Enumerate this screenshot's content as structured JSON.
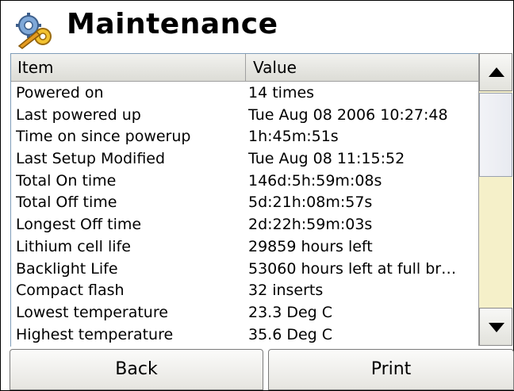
{
  "window": {
    "title": "Maintenance",
    "icon": "gears-icon"
  },
  "table": {
    "columns": [
      "Item",
      "Value"
    ],
    "rows": [
      [
        "Powered on",
        "14 times"
      ],
      [
        "Last powered up",
        "Tue Aug 08 2006 10:27:48"
      ],
      [
        "Time on since powerup",
        "1h:45m:51s"
      ],
      [
        "Last Setup Modified",
        "Tue Aug 08 11:15:52"
      ],
      [
        "Total On time",
        "146d:5h:59m:08s"
      ],
      [
        "Total Off time",
        "5d:21h:08m:57s"
      ],
      [
        "Longest Off time",
        "2d:22h:59m:03s"
      ],
      [
        "Lithium cell life",
        "29859 hours left"
      ],
      [
        "Backlight Life",
        "53060 hours left at full br…"
      ],
      [
        "Compact flash",
        "32 inserts"
      ],
      [
        "Lowest temperature",
        "23.3 Deg C"
      ],
      [
        "Highest temperature",
        "35.6 Deg C"
      ]
    ]
  },
  "scrollbar": {
    "up_icon": "arrow-up-icon",
    "down_icon": "arrow-down-icon",
    "track_color": "#f5f0c9"
  },
  "buttons": {
    "back_label": "Back",
    "print_label": "Print"
  }
}
